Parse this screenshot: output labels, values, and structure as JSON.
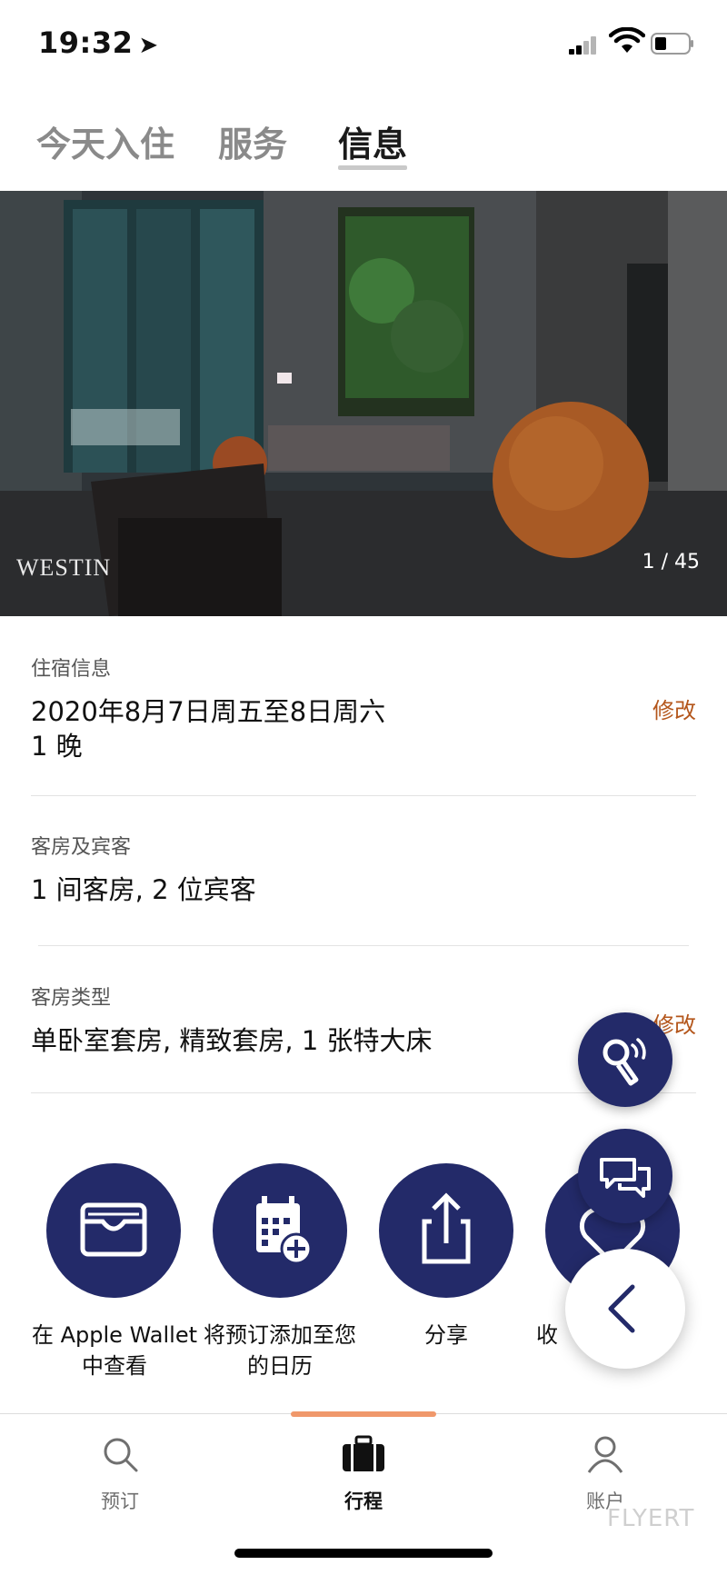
{
  "status_bar": {
    "time": "19:32"
  },
  "tabs": [
    {
      "label": "今天入住",
      "active": false
    },
    {
      "label": "服务",
      "active": false
    },
    {
      "label": "信息",
      "active": true
    }
  ],
  "hero": {
    "brand": "WESTIN",
    "counter": "1 / 45"
  },
  "stay": {
    "label": "住宿信息",
    "dates": "2020年8月7日周五至8日周六",
    "nights": "1 晚",
    "edit_label": "修改"
  },
  "rooms": {
    "label": "客房及宾客",
    "value": "1 间客房, 2 位宾客"
  },
  "room_type": {
    "label": "客房类型",
    "value": "单卧室套房, 精致套房, 1  张特大床",
    "edit_label": "修改"
  },
  "actions": [
    {
      "icon": "wallet-icon",
      "label_line1": "在 Apple Wallet",
      "label_line2": "中查看"
    },
    {
      "icon": "calendar-add-icon",
      "label_line1": "将预订添加至您",
      "label_line2": "的日历"
    },
    {
      "icon": "share-icon",
      "label_line1": "分享",
      "label_line2": ""
    },
    {
      "icon": "heart-icon",
      "label_line1": "收",
      "label_line2": ""
    }
  ],
  "fabs": [
    "mobile-key-icon",
    "chat-icon",
    "back-icon"
  ],
  "bottom_nav": [
    {
      "icon": "search-icon",
      "label": "预订",
      "active": false
    },
    {
      "icon": "briefcase-icon",
      "label": "行程",
      "active": true
    },
    {
      "icon": "user-icon",
      "label": "账户",
      "active": false
    }
  ],
  "watermark": "FLYERT",
  "colors": {
    "navy": "#232a69",
    "accent_orange": "#b4561b",
    "nav_accent": "#f0986b"
  }
}
